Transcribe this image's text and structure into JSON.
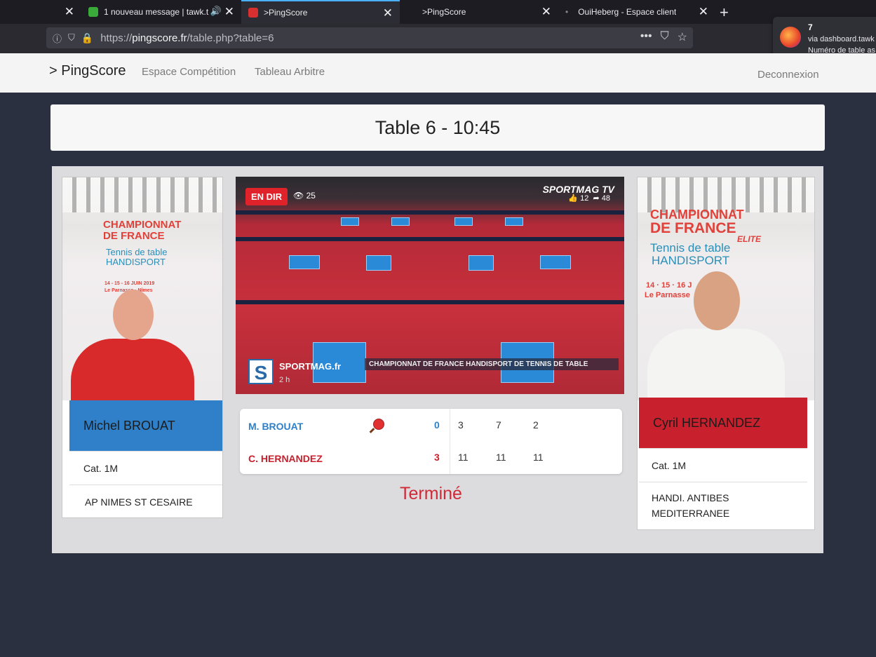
{
  "browser": {
    "tabs": [
      {
        "title": "",
        "active": false
      },
      {
        "title": "1 nouveau message | tawk.t",
        "active": false,
        "audio": true
      },
      {
        "title": ">PingScore",
        "active": true
      },
      {
        "title": ">PingScore",
        "active": false
      },
      {
        "title": "OuiHeberg - Espace client",
        "active": false
      }
    ],
    "url_prefix": "https://",
    "url_domain": "pingscore.fr",
    "url_path": "/table.php?table=6"
  },
  "notification": {
    "count": "7",
    "line1": "via dashboard.tawk",
    "line2": "Numéro de table as"
  },
  "site": {
    "brand": "> PingScore",
    "nav": [
      "Espace Compétition",
      "Tableau Arbitre"
    ],
    "logout": "Deconnexion"
  },
  "table_title": "Table 6 - 10:45",
  "player1": {
    "name": "Michel BROUAT",
    "category": "Cat. 1M",
    "club": "AP NIMES ST CESAIRE",
    "color": "#2f80c8"
  },
  "player2": {
    "name": "Cyril HERNANDEZ",
    "category": "Cat. 1M",
    "club_line1": "HANDI. ANTIBES",
    "club_line2": "MEDITERRANEE",
    "color": "#c8202c"
  },
  "poster": {
    "line1": "CHAMPIONNAT",
    "line2": "DE FRANCE",
    "elite": "ELITE",
    "line3": "Tennis de table",
    "line4": "HANDISPORT",
    "date_left": "14 - 15 - 16 JUIN 2019",
    "date_right": "14 · 15 · 16 J",
    "venue_left": "Le Parnasse · Nîmes",
    "venue_right": "Le Parnasse"
  },
  "video": {
    "live": "EN DIR",
    "views": "25",
    "brand": "SPORTMAG TV",
    "likes": "12",
    "shares": "48",
    "source": "SPORTMAG.fr",
    "age": "2 h",
    "ticker": "CHAMPIONNAT DE FRANCE HANDISPORT DE TENNIS DE TABLE"
  },
  "score": {
    "p1_name": "M. BROUAT",
    "p2_name": "C. HERNANDEZ",
    "p1_sets": "0",
    "p2_sets": "3",
    "p1_games": [
      "3",
      "7",
      "2"
    ],
    "p2_games": [
      "11",
      "11",
      "11"
    ]
  },
  "status": "Terminé"
}
